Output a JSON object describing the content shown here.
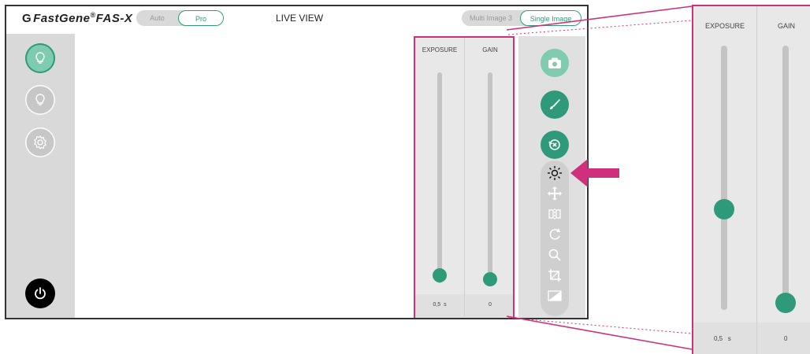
{
  "header": {
    "logo_text": "FastGene",
    "logo_model": "FAS-X",
    "mode_toggle": {
      "options": [
        "Auto",
        "Pro"
      ],
      "selected": "Pro"
    },
    "title": "LIVE VIEW",
    "view_toggle": {
      "options": [
        "Multi Image 3",
        "Single Image"
      ],
      "selected": "Single Image"
    }
  },
  "left_sidebar": {
    "buttons": [
      {
        "icon": "bulb-icon",
        "state": "active"
      },
      {
        "icon": "bulb-icon",
        "state": "inactive"
      },
      {
        "icon": "gear-icon",
        "state": "inactive"
      },
      {
        "icon": "power-icon",
        "state": "default"
      }
    ]
  },
  "sliders": {
    "exposure": {
      "label": "EXPOSURE",
      "value": "0,5",
      "unit": "s",
      "level": 0.02
    },
    "gain": {
      "label": "GAIN",
      "value": "0",
      "level": 0.0
    }
  },
  "zoom_sliders": {
    "exposure": {
      "label": "EXPOSURE",
      "value": "0,5",
      "unit": "s",
      "level": 0.38
    },
    "gain": {
      "label": "GAIN",
      "value": "0",
      "level": 0.0
    }
  },
  "right_toolbar": {
    "buttons": [
      "camera-icon",
      "brush-icon",
      "reset-exposure-icon"
    ],
    "tools": [
      "brightness-icon",
      "move-icon",
      "flip-icon",
      "rotate-icon",
      "zoom-icon",
      "crop-icon",
      "invert-icon"
    ]
  },
  "colors": {
    "accent": "#2f9a79",
    "accent_light": "#7fcbb0",
    "highlight": "#cf2f7d",
    "panel": "#d9d9d9"
  }
}
